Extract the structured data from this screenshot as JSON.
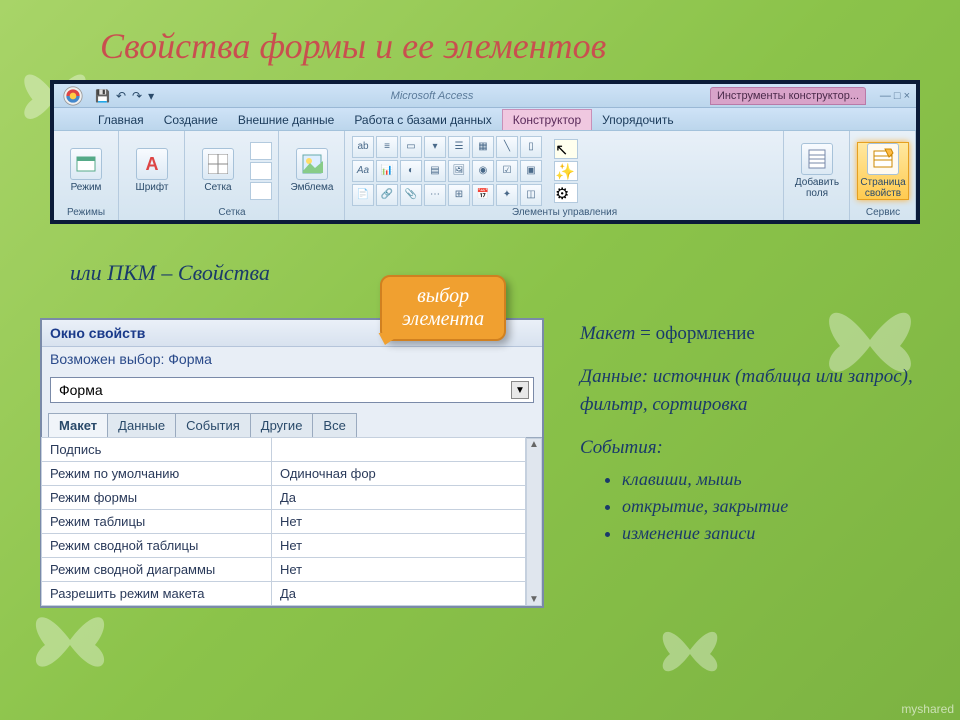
{
  "slide_title": "Свойства формы и ее элементов",
  "subtitle": "или ПКМ – Свойства",
  "watermark": "myshared",
  "titlebar": {
    "app_name": "Microsoft Access",
    "contextual_tools": "Инструменты конструктор...",
    "window_controls": "— □ ×"
  },
  "qat": {
    "save": "💾",
    "undo": "↶",
    "redo": "↷"
  },
  "tabs": {
    "home": "Главная",
    "create": "Создание",
    "external": "Внешние данные",
    "database": "Работа с базами данных",
    "designer": "Конструктор",
    "arrange": "Упорядочить"
  },
  "ribbon_groups": {
    "views": {
      "btn": "Режим",
      "label": "Режимы"
    },
    "font": {
      "btn": "Шрифт",
      "label": ""
    },
    "grid": {
      "btn": "Сетка",
      "label": "Сетка"
    },
    "logo": {
      "btn": "Эмблема",
      "label": ""
    },
    "controls": {
      "label": "Элементы управления"
    },
    "addfields": {
      "btn": "Добавить поля",
      "label": ""
    },
    "propsheet": {
      "btn": "Страница свойств",
      "label": "Сервис"
    }
  },
  "callout": {
    "line1": "выбор",
    "line2": "элемента"
  },
  "props": {
    "title": "Окно свойств",
    "subtitle": "Возможен выбор: Форма",
    "selected": "Форма",
    "tabs": {
      "layout": "Макет",
      "data": "Данные",
      "events": "События",
      "other": "Другие",
      "all": "Все"
    },
    "rows": [
      {
        "name": "Подпись",
        "value": ""
      },
      {
        "name": "Режим по умолчанию",
        "value": "Одиночная фор"
      },
      {
        "name": "Режим формы",
        "value": "Да"
      },
      {
        "name": "Режим таблицы",
        "value": "Нет"
      },
      {
        "name": "Режим сводной таблицы",
        "value": "Нет"
      },
      {
        "name": "Режим сводной диаграммы",
        "value": "Нет"
      },
      {
        "name": "Разрешить режим макета",
        "value": "Да"
      }
    ]
  },
  "ann": {
    "layout_label": "Макет",
    "layout_eq": " = оформление",
    "data_label": "Данные: ",
    "data_text": "источник (таблица или запрос), фильтр, сортировка",
    "events_label": "События:",
    "events": {
      "e1": "клавиши, мышь",
      "e2": "открытие, закрытие",
      "e3": "изменение записи"
    }
  }
}
